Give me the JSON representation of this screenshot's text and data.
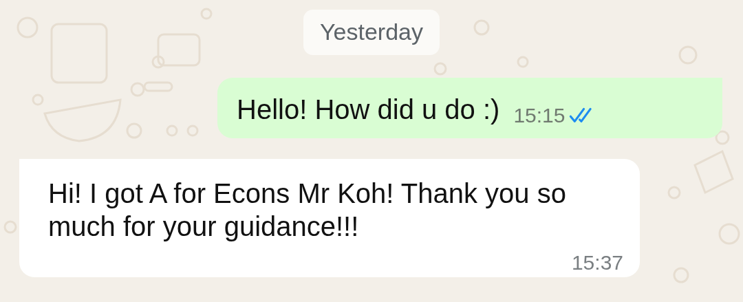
{
  "date_chip": "Yesterday",
  "messages": [
    {
      "kind": "outgoing",
      "text": "Hello! How did u do :)",
      "time": "15:15",
      "read": true
    },
    {
      "kind": "incoming",
      "text": "Hi! I got A for Econs Mr Koh! Thank you so much for your guidance!!!",
      "time": "15:37"
    }
  ]
}
